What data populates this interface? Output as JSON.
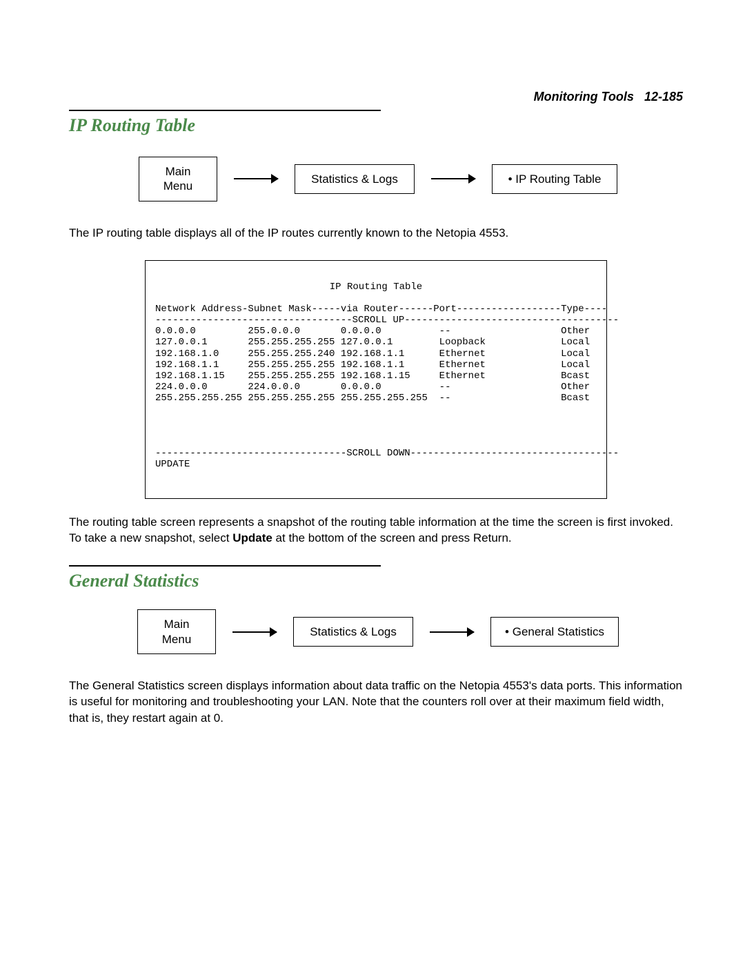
{
  "header": {
    "running_title": "Monitoring Tools",
    "page_ref": "12-185"
  },
  "section1": {
    "title": "IP Routing Table",
    "nav": {
      "box1_line1": "Main",
      "box1_line2": "Menu",
      "box2": "Statistics & Logs",
      "box3_prefix": "• ",
      "box3": "IP Routing Table"
    },
    "p_intro": "The IP routing table displays all of the IP routes currently known to the Netopia 4553.",
    "terminal": {
      "title": "IP Routing Table",
      "header_line": "Network Address-Subnet Mask-----via Router------Port------------------Type----",
      "scroll_up": "----------------------------------SCROLL UP-------------------------------------",
      "rows": [
        "0.0.0.0         255.0.0.0       0.0.0.0          --                   Other",
        "127.0.0.1       255.255.255.255 127.0.0.1        Loopback             Local",
        "192.168.1.0     255.255.255.240 192.168.1.1      Ethernet             Local",
        "192.168.1.1     255.255.255.255 192.168.1.1      Ethernet             Local",
        "192.168.1.15    255.255.255.255 192.168.1.15     Ethernet             Bcast",
        "224.0.0.0       224.0.0.0       0.0.0.0          --                   Other",
        "255.255.255.255 255.255.255.255 255.255.255.255  --                   Bcast"
      ],
      "scroll_down": "---------------------------------SCROLL DOWN------------------------------------",
      "update": "UPDATE"
    },
    "p_after": {
      "pre": "The routing table screen represents a snapshot of the routing table information at the time the screen is first invoked. To take a new snapshot, select ",
      "bold": "Update",
      "post": " at the bottom of the screen and press Return."
    }
  },
  "section2": {
    "title": "General Statistics",
    "nav": {
      "box1_line1": "Main",
      "box1_line2": "Menu",
      "box2": "Statistics & Logs",
      "box3_prefix": "• ",
      "box3": "General Statistics"
    },
    "p_intro": "The General Statistics screen displays information about data traffic on the Netopia 4553's data ports. This information is useful for monitoring and troubleshooting your LAN. Note that the counters roll over at their maximum field width, that is, they restart again at 0."
  }
}
